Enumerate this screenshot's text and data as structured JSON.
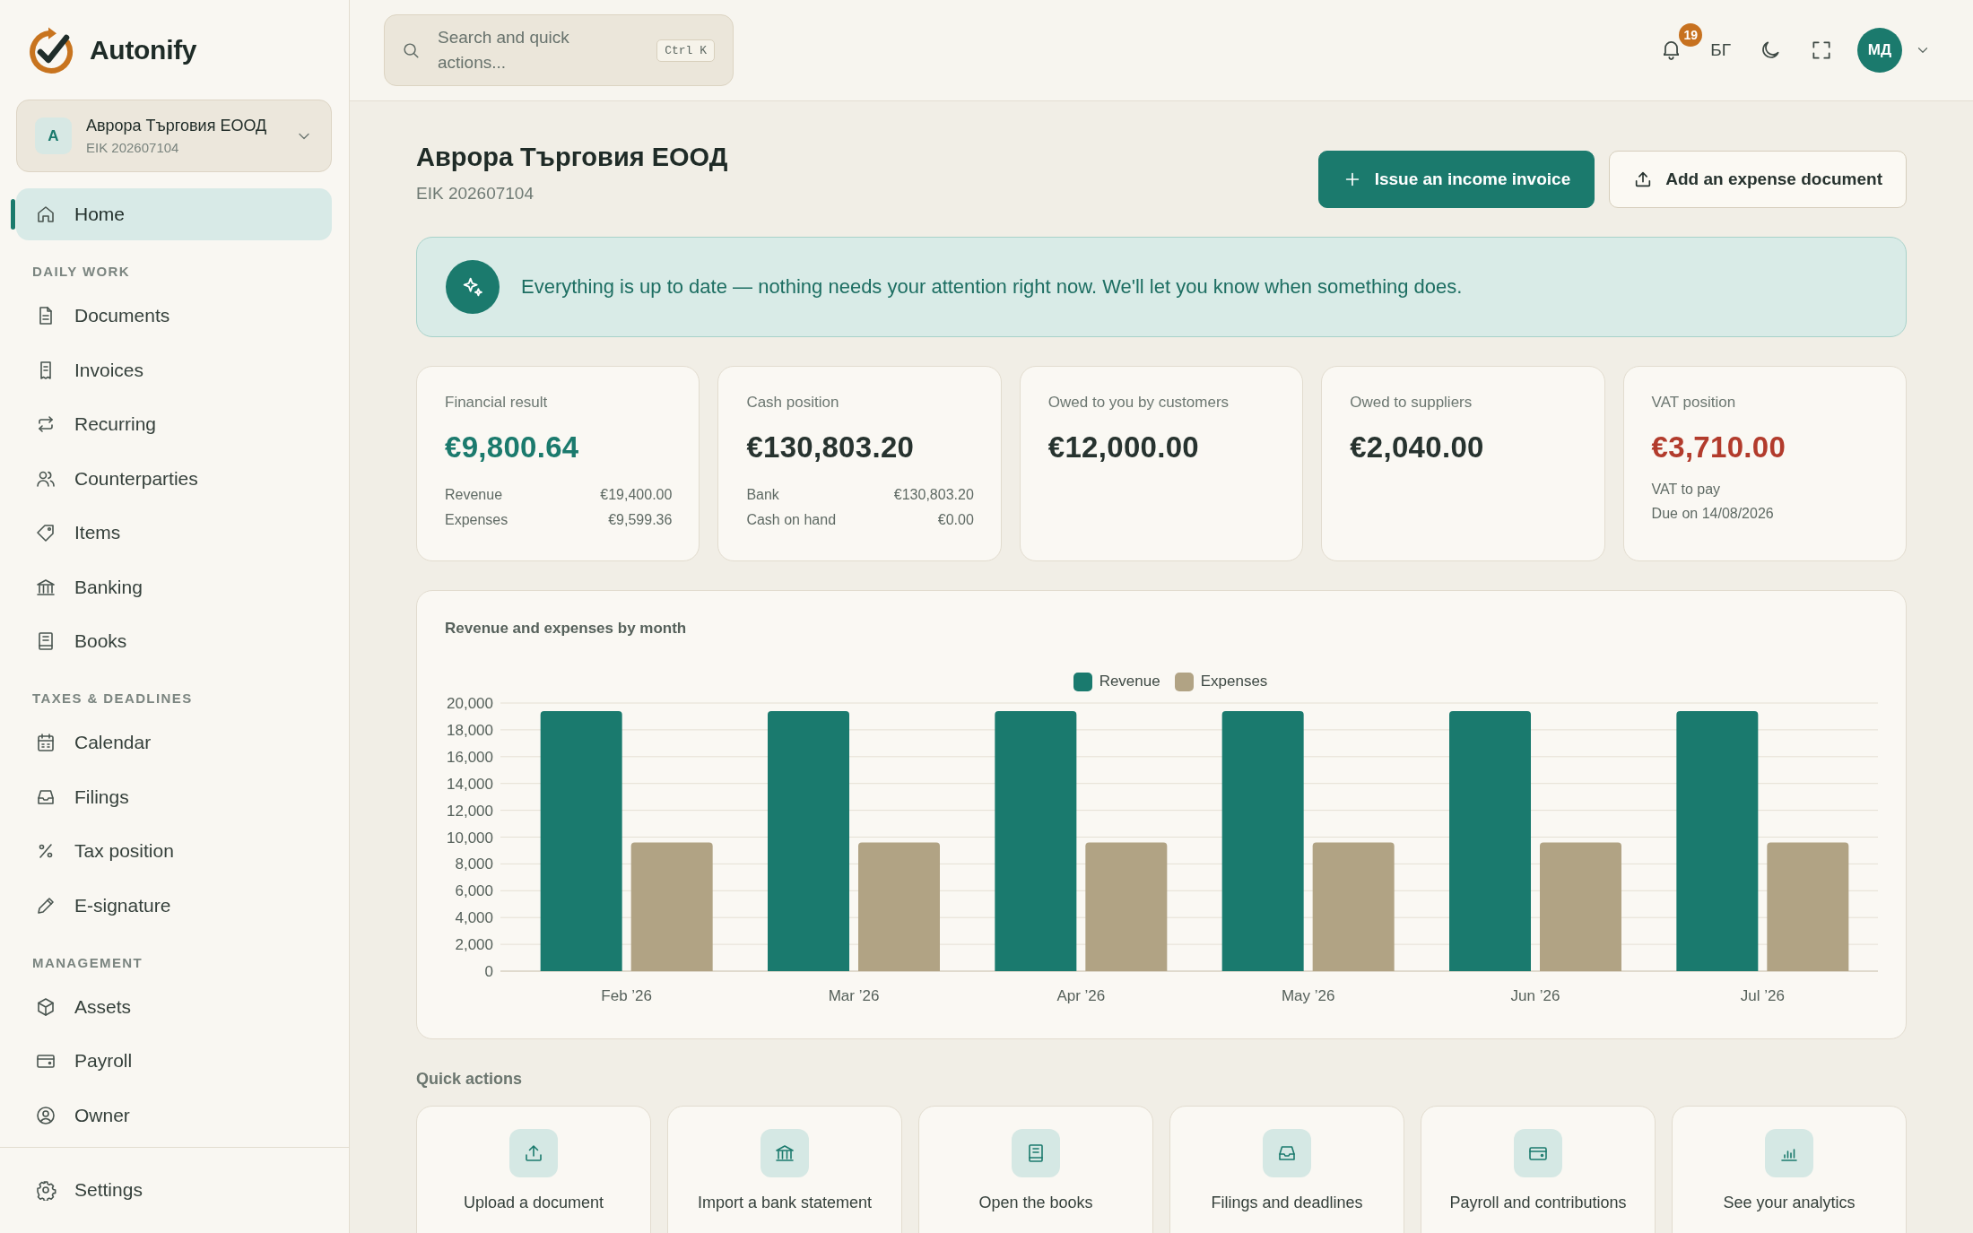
{
  "sidebar": {
    "brand": "Autonify",
    "company": {
      "initial": "A",
      "name": "Аврора Търговия ЕООД",
      "eik": "EIK 202607104"
    },
    "nav": [
      {
        "items": [
          {
            "label": "Home",
            "selected": true
          }
        ]
      },
      {
        "title": "DAILY WORK",
        "items": [
          {
            "label": "Documents",
            "selected": false
          },
          {
            "label": "Invoices",
            "selected": false
          },
          {
            "label": "Recurring",
            "selected": false
          },
          {
            "label": "Counterparties",
            "selected": false
          },
          {
            "label": "Items",
            "selected": false
          },
          {
            "label": "Banking",
            "selected": false
          },
          {
            "label": "Books",
            "selected": false
          }
        ]
      },
      {
        "title": "TAXES & DEADLINES",
        "items": [
          {
            "label": "Calendar",
            "selected": false
          },
          {
            "label": "Filings",
            "selected": false
          },
          {
            "label": "Tax position",
            "selected": false
          },
          {
            "label": "E-signature",
            "selected": false
          }
        ]
      },
      {
        "title": "MANAGEMENT",
        "items": [
          {
            "label": "Assets",
            "selected": false
          },
          {
            "label": "Payroll",
            "selected": false
          },
          {
            "label": "Owner",
            "selected": false
          }
        ]
      }
    ],
    "footer_nav": [
      {
        "label": "Settings",
        "selected": false
      }
    ]
  },
  "topbar": {
    "search": {
      "placeholder": "Search and quick actions...",
      "shortcut": "Ctrl K"
    },
    "notifications": {
      "count": "19"
    },
    "language": "БГ",
    "user": {
      "initials": "МД"
    }
  },
  "page_header": {
    "title": "Аврора Търговия ЕООД",
    "subtitle": "EIK 202607104",
    "actions": [
      {
        "kind": "primary",
        "label": "Issue an income invoice"
      },
      {
        "kind": "secondary",
        "label": "Add an expense document"
      }
    ]
  },
  "status_banner": {
    "text": "Everything is up to date — nothing needs your attention right now. We'll let you know when something does."
  },
  "summary_cards": [
    {
      "label": "Financial result",
      "value": "€9,800.64",
      "color": "#1b7a6d",
      "rows": [
        {
          "label": "Revenue",
          "value": "€19,400.00"
        },
        {
          "label": "Expenses",
          "value": "€9,599.36"
        }
      ]
    },
    {
      "label": "Cash position",
      "value": "€130,803.20",
      "color": "#27332f",
      "rows": [
        {
          "label": "Bank",
          "value": "€130,803.20"
        },
        {
          "label": "Cash on hand",
          "value": "€0.00"
        }
      ]
    },
    {
      "label": "Owed to you by customers",
      "value": "€12,000.00",
      "color": "#27332f"
    },
    {
      "label": "Owed to suppliers",
      "value": "€2,040.00",
      "color": "#27332f"
    },
    {
      "label": "VAT position",
      "value": "€3,710.00",
      "color": "#b23b2c",
      "notes": [
        "VAT to pay",
        "Due on 14/08/2026"
      ]
    }
  ],
  "chart_panel": {
    "chart_data": {
      "type": "bar",
      "title": "Revenue and expenses by month",
      "categories": [
        "Feb ’26",
        "Mar ’26",
        "Apr ’26",
        "May ’26",
        "Jun ’26",
        "Jul ’26"
      ],
      "series": [
        {
          "name": "Revenue",
          "color": "#1a7a6e",
          "values": [
            19400,
            19400,
            19400,
            19400,
            19400,
            19400
          ]
        },
        {
          "name": "Expenses",
          "color": "#b1a384",
          "values": [
            9600,
            9600,
            9600,
            9600,
            9600,
            9600
          ]
        }
      ],
      "ylim": [
        0,
        20000
      ],
      "yticks": [
        {
          "value": 0,
          "label": "0"
        },
        {
          "value": 2000,
          "label": "2,000"
        },
        {
          "value": 4000,
          "label": "4,000"
        },
        {
          "value": 6000,
          "label": "6,000"
        },
        {
          "value": 8000,
          "label": "8,000"
        },
        {
          "value": 10000,
          "label": "10,000"
        },
        {
          "value": 12000,
          "label": "12,000"
        },
        {
          "value": 14000,
          "label": "14,000"
        },
        {
          "value": 16000,
          "label": "16,000"
        },
        {
          "value": 18000,
          "label": "18,000"
        },
        {
          "value": 20000,
          "label": "20,000"
        }
      ],
      "grid": true,
      "legend": "top"
    }
  },
  "quick_actions": {
    "title": "Quick actions",
    "items": [
      "Upload a document",
      "Import a bank statement",
      "Open the books",
      "Filings and deadlines",
      "Payroll and contributions",
      "See your analytics"
    ]
  }
}
